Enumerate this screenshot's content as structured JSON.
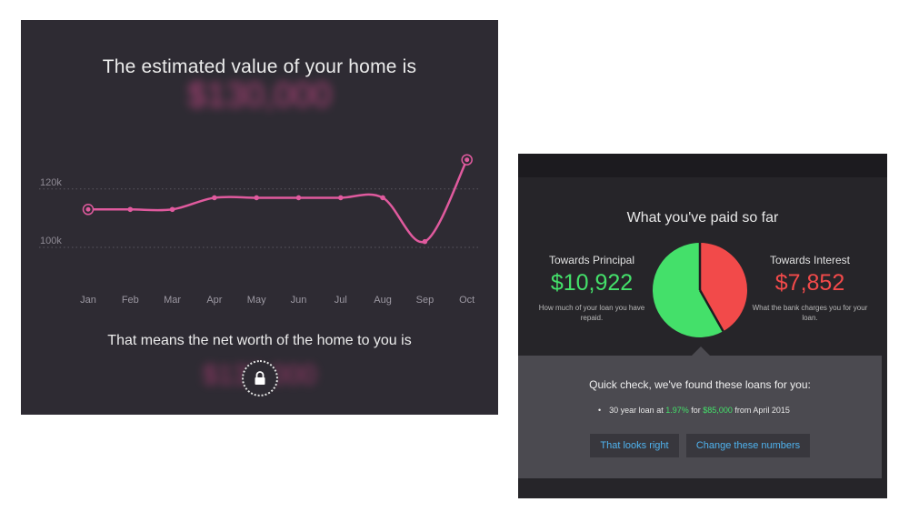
{
  "home_value": {
    "title": "The estimated value of your home is",
    "value_blurred": "$130,000",
    "net_worth_label": "That means the net worth of the home to you is",
    "net_worth_blurred": "$130,000"
  },
  "chart_data": {
    "type": "line",
    "categories": [
      "Jan",
      "Feb",
      "Mar",
      "Apr",
      "May",
      "Jun",
      "Jul",
      "Aug",
      "Sep",
      "Oct"
    ],
    "series": [
      {
        "values": [
          113000,
          113000,
          113000,
          117000,
          117000,
          117000,
          117000,
          117000,
          102000,
          130000
        ]
      }
    ],
    "y_ticks": [
      {
        "value": 120000,
        "label": "120k"
      },
      {
        "value": 100000,
        "label": "100k"
      }
    ],
    "ylim": [
      86000,
      138000
    ],
    "grid": "dotted horizontal at ticks",
    "color": "#e05a9e"
  },
  "paid": {
    "title": "What you've paid so far",
    "principal_label": "Towards Principal",
    "principal_amount": "$10,922",
    "principal_desc": "How much of your loan you have repaid.",
    "interest_label": "Towards Interest",
    "interest_amount": "$7,852",
    "interest_desc": "What the bank charges you for your loan.",
    "principal_value": 10922,
    "interest_value": 7852,
    "colors": {
      "principal": "#44e06a",
      "interest": "#f24a4a"
    }
  },
  "loans": {
    "heading": "Quick check, we've found these loans for you:",
    "item_prefix": "30 year loan at",
    "rate": "1.97%",
    "item_mid": "for",
    "amount": "$85,000",
    "item_suffix": "from April 2015",
    "btn_right": "That looks right",
    "btn_change": "Change these numbers"
  }
}
